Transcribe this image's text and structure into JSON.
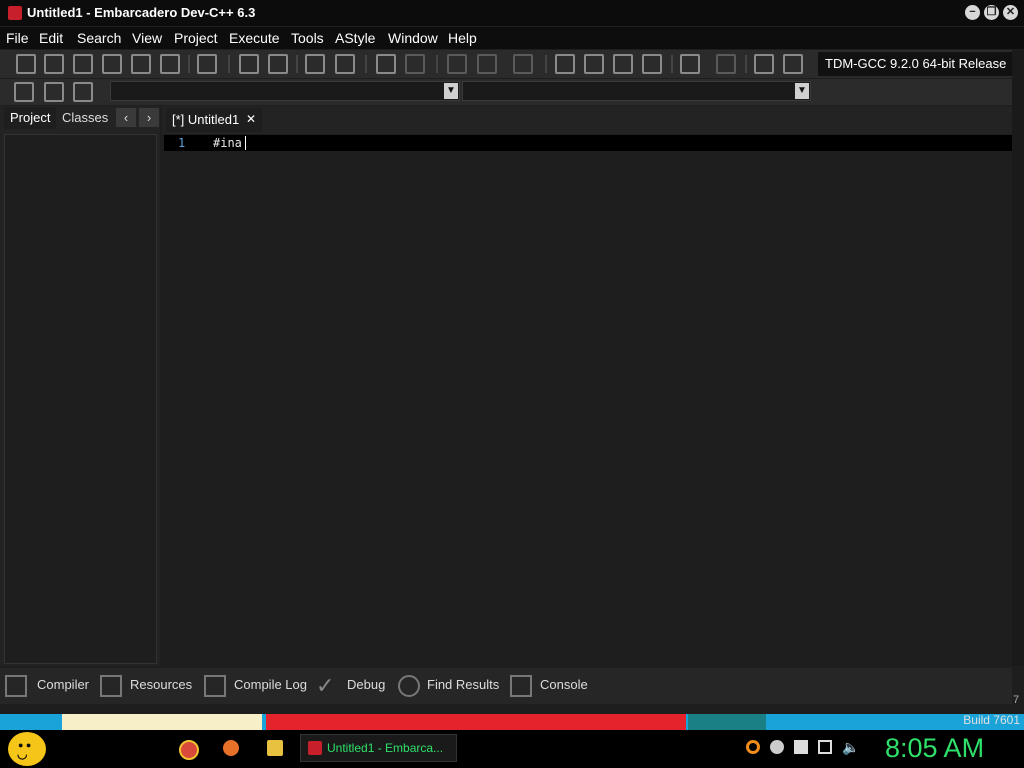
{
  "window": {
    "title": "Untitled1 - Embarcadero Dev-C++ 6.3",
    "controls": [
      "−",
      "❐",
      "✕"
    ]
  },
  "menu": {
    "items": [
      "File",
      "Edit",
      "Search",
      "View",
      "Project",
      "Execute",
      "Tools",
      "AStyle",
      "Window",
      "Help"
    ]
  },
  "toolbar": {
    "compiler": "TDM-GCC 9.2.0 64-bit Release"
  },
  "left_panel": {
    "tabs": [
      "Project",
      "Classes"
    ],
    "prev": "‹",
    "next": "›"
  },
  "editor": {
    "tab_label": "[*] Untitled1",
    "close": "✕",
    "line_number": "1",
    "code": "#ina"
  },
  "bottom_tabs": [
    "Compiler",
    "Resources",
    "Compile Log",
    "Debug",
    "Find Results",
    "Console"
  ],
  "desktop": {
    "build_text": "Build 7601",
    "corner_digit": "7"
  },
  "taskbar": {
    "app_label": "Untitled1 - Embarca...",
    "clock": "8:05 AM"
  },
  "colors": {
    "accent_green": "#2ee06a",
    "line_number_blue": "#5aa0d8",
    "devcpp_red": "#c8202a"
  }
}
